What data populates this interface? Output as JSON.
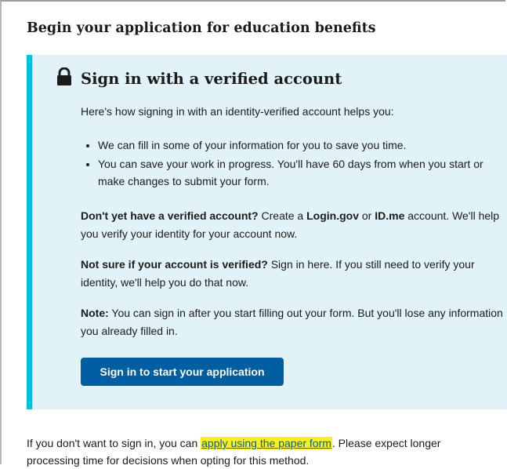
{
  "page": {
    "title": "Begin your application for education benefits"
  },
  "alert": {
    "heading": "Sign in with a verified account",
    "icon": "lock-icon",
    "border_color": "#00bde3",
    "background_color": "#e1f3f8",
    "intro": "Here's how signing in with an identity-verified account helps you:",
    "bullets": [
      "We can fill in some of your information for you to save you time.",
      "You can save your work in progress. You'll have 60 days from when you start or make changes to submit your form."
    ],
    "p1": {
      "lead": "Don't yet have a verified account?",
      "text_a": " Create a ",
      "login_gov": "Login.gov",
      "text_b": " or ",
      "id_me": "ID.me",
      "text_c": " account. We'll help you verify your identity for your account now."
    },
    "p2": {
      "lead": "Not sure if your account is verified?",
      "text": " Sign in here. If you still need to verify your identity, we'll help you do that now."
    },
    "p3": {
      "lead": "Note:",
      "text": " You can sign in after you start filling out your form. But you'll lose any information you already filled in."
    },
    "button_label": "Sign in to start your application",
    "button_color": "#005ea2"
  },
  "footer": {
    "text_a": "If you don't want to sign in, you can ",
    "link": "apply using the paper form",
    "text_b": ". Please expect longer processing time for decisions when opting for this method."
  }
}
